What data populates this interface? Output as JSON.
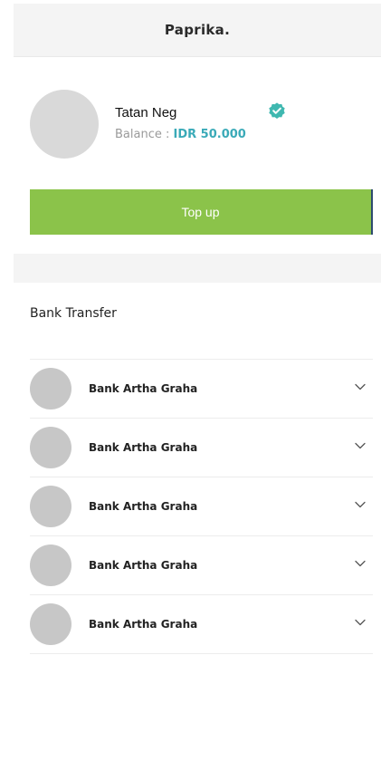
{
  "header": {
    "title": "Paprika."
  },
  "profile": {
    "name": "Tatan Neg",
    "balance_label": "Balance : ",
    "balance_value": "IDR 50.000",
    "verified_icon": "verified-badge-icon"
  },
  "actions": {
    "topup_label": "Top up"
  },
  "bank_transfer": {
    "title": "Bank Transfer",
    "items": [
      {
        "name": "Bank Artha Graha"
      },
      {
        "name": "Bank Artha Graha"
      },
      {
        "name": "Bank Artha Graha"
      },
      {
        "name": "Bank Artha Graha"
      },
      {
        "name": "Bank Artha Graha"
      }
    ]
  },
  "colors": {
    "accent_green": "#8bc34a",
    "balance_teal": "#3aaab8",
    "verified_teal": "#3fb8b0"
  }
}
